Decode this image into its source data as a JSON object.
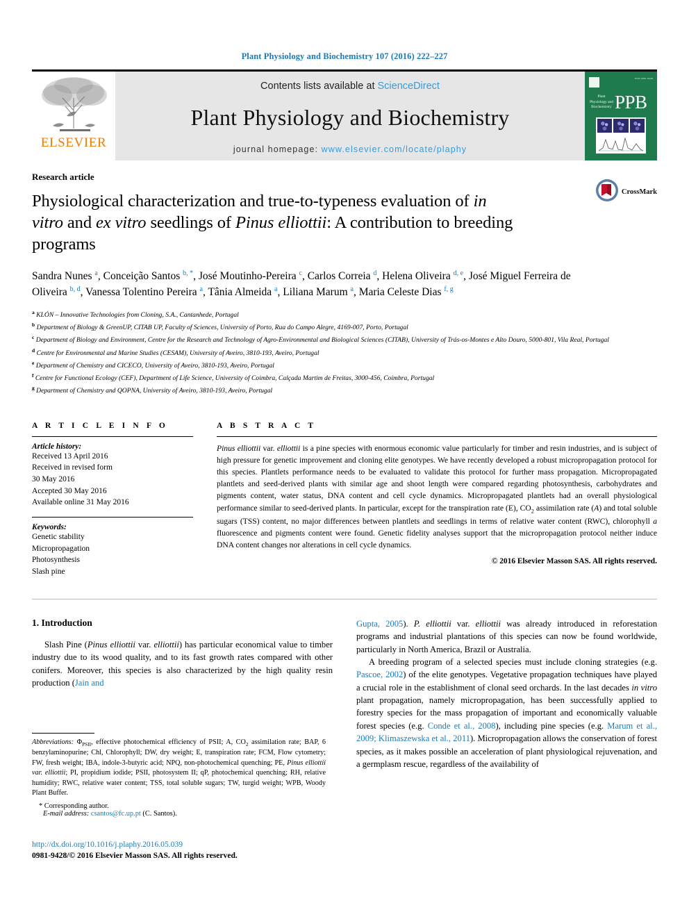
{
  "running_head": "Plant Physiology and Biochemistry 107 (2016) 222–227",
  "masthead": {
    "contents_prefix": "Contents lists available at ",
    "contents_link": "ScienceDirect",
    "journal_title": "Plant Physiology and Biochemistry",
    "homepage_prefix": "journal homepage: ",
    "homepage_url": "www.elsevier.com/locate/plaphy",
    "publisher_wordmark": "ELSEVIER",
    "publisher_logo_icon": "elsevier-tree-icon",
    "cover": {
      "abbrev": "PPB",
      "journal_name_lines": "Plant Physiology and Biochemistry",
      "issn_text": "ISSN 0981-9428"
    },
    "accent_link_color": "#3a9ad9",
    "elsevier_orange": "#f07c00",
    "cover_green": "#1f7a4d"
  },
  "article": {
    "type": "Research article",
    "title_parts": [
      {
        "text": "Physiological characterization and true-to-typeness evaluation of ",
        "italic": false
      },
      {
        "text": "in vitro",
        "italic": true
      },
      {
        "text": " and ",
        "italic": false
      },
      {
        "text": "ex vitro",
        "italic": true
      },
      {
        "text": " seedlings of ",
        "italic": false
      },
      {
        "text": "Pinus elliottii",
        "italic": true
      },
      {
        "text": ": A contribution to breeding programs",
        "italic": false
      }
    ],
    "title_plain": "Physiological characterization and true-to-typeness evaluation of in vitro and ex vitro seedlings of Pinus elliottii: A contribution to breeding programs",
    "crossmark_label": "CrossMark",
    "crossmark_icon": "crossmark-badge-icon",
    "authors": [
      {
        "name": "Sandra Nunes",
        "sup": "a"
      },
      {
        "name": "Conceição Santos",
        "sup": "b, *"
      },
      {
        "name": "José Moutinho-Pereira",
        "sup": "c"
      },
      {
        "name": "Carlos Correia",
        "sup": "d"
      },
      {
        "name": "Helena Oliveira",
        "sup": "d, e"
      },
      {
        "name": "José Miguel Ferreira de Oliveira",
        "sup": "b, d"
      },
      {
        "name": "Vanessa Tolentino Pereira",
        "sup": "a"
      },
      {
        "name": "Tânia Almeida",
        "sup": "a"
      },
      {
        "name": "Liliana Marum",
        "sup": "a"
      },
      {
        "name": "Maria Celeste Dias",
        "sup": "f, g"
      }
    ],
    "affiliations": [
      {
        "sup": "a",
        "text": "KLÓN – Innovative Technologies from Cloning, S.A., Cantanhede, Portugal"
      },
      {
        "sup": "b",
        "text": "Department of Biology & GreenUP, CITAB UP, Faculty of Sciences, University of Porto, Rua do Campo Alegre, 4169-007, Porto, Portugal"
      },
      {
        "sup": "c",
        "text": "Department of Biology and Environment, Centre for the Research and Technology of Agro-Environmental and Biological Sciences (CITAB), University of Trás-os-Montes e Alto Douro, 5000-801, Vila Real, Portugal"
      },
      {
        "sup": "d",
        "text": "Centre for Environmental and Marine Studies (CESAM), University of Aveiro, 3810-193, Aveiro, Portugal"
      },
      {
        "sup": "e",
        "text": "Department of Chemistry and CICECO, University of Aveiro, 3810-193, Aveiro, Portugal"
      },
      {
        "sup": "f",
        "text": "Centre for Functional Ecology (CEF), Department of Life Science, University of Coimbra, Calçada Martim de Freitas, 3000-456, Coimbra, Portugal"
      },
      {
        "sup": "g",
        "text": "Department of Chemistry and QOPNA, University of Aveiro, 3810-193, Aveiro, Portugal"
      }
    ]
  },
  "article_info": {
    "heading": "A R T I C L E   I N F O",
    "history_label": "Article history:",
    "history": [
      "Received 13 April 2016",
      "Received in revised form",
      "30 May 2016",
      "Accepted 30 May 2016",
      "Available online 31 May 2016"
    ],
    "keywords_label": "Keywords:",
    "keywords": [
      "Genetic stability",
      "Micropropagation",
      "Photosynthesis",
      "Slash pine"
    ]
  },
  "abstract": {
    "heading": "A B S T R A C T",
    "text_html": "<i>Pinus elliottii</i> var. <i>elliottii</i> is a pine species with enormous economic value particularly for timber and resin industries, and is subject of high pressure for genetic improvement and cloning elite genotypes. We have recently developed a robust micropropagation protocol for this species. Plantlets performance needs to be evaluated to validate this protocol for further mass propagation. Micropropagated plantlets and seed-derived plants with similar age and shoot length were compared regarding photosynthesis, carbohydrates and pigments content, water status, DNA content and cell cycle dynamics. Micropropagated plantlets had an overall physiological performance similar to seed-derived plants. In particular, except for the transpiration rate (E), CO<sub>2</sub> assimilation rate (<i>A</i>) and total soluble sugars (TSS) content, no major differences between plantlets and seedlings in terms of relative water content (RWC), chlorophyll <i>a</i> fluorescence and pigments content were found. Genetic fidelity analyses support that the micropropagation protocol neither induce DNA content changes nor alterations in cell cycle dynamics.",
    "copyright": "© 2016 Elsevier Masson SAS. All rights reserved."
  },
  "introduction": {
    "section_title": "1. Introduction",
    "col_left_html": "Slash Pine (<i>Pinus elliottii</i> var. <i>elliottii</i>) has particular economical value to timber industry due to its wood quality, and to its fast growth rates compared with other conifers. Moreover, this species is also characterized by the high quality resin production (<span class=\"ref\">Jain and</span>",
    "col_right_p1_html": "<span class=\"ref\">Gupta, 2005</span>). <i>P. elliottii</i> var. <i>elliottii</i> was already introduced in reforestation programs and industrial plantations of this species can now be found worldwide, particularly in North America, Brazil or Australia.",
    "col_right_p2_html": "A breeding program of a selected species must include cloning strategies (e.g. <span class=\"ref\">Pascoe, 2002</span>) of the elite genotypes. Vegetative propagation techniques have played a crucial role in the establishment of clonal seed orchards. In the last decades <i>in vitro</i> plant propagation, namely micropropagation, has been successfully applied to forestry species for the mass propagation of important and economically valuable forest species (e.g. <span class=\"ref\">Conde et al., 2008</span>), including pine species (e.g. <span class=\"ref\">Marum et al., 2009; Klimaszewska et al., 2011</span>). Micropropagation allows the conservation of forest species, as it makes possible an acceleration of plant physiological rejuvenation, and a germplasm rescue, regardless of the availability of"
  },
  "footnotes": {
    "abbreviations_html": "<i>Abbreviations:</i> Φ<sub>PSII</sub>, effective photochemical efficiency of PSII; A, CO<sub>2</sub> assimilation rate; BAP, 6 benzylaminopurine; Chl, Chlorophyll; DW, dry weight; E, transpiration rate; FCM, Flow cytometry; FW, fresh weight; IBA, indole-3-butyric acid; NPQ, non-photochemical quenching; PE, <i>Pinus elliottii var. elliottii</i>; PI, propidium iodide; PSII, photosystem II; qP, photochemical quenching; RH, relative humidity; RWC, relative water content; TSS, total soluble sugars; TW, turgid weight; WPB, Woody Plant Buffer.",
    "corresponding_author": "* Corresponding author.",
    "email_label": "E-mail address:",
    "email_value": "csantos@fc.up.pt",
    "email_owner": "(C. Santos).",
    "doi_url": "http://dx.doi.org/10.1016/j.plaphy.2016.05.039",
    "issn_copyright": "0981-9428/© 2016 Elsevier Masson SAS. All rights reserved."
  }
}
